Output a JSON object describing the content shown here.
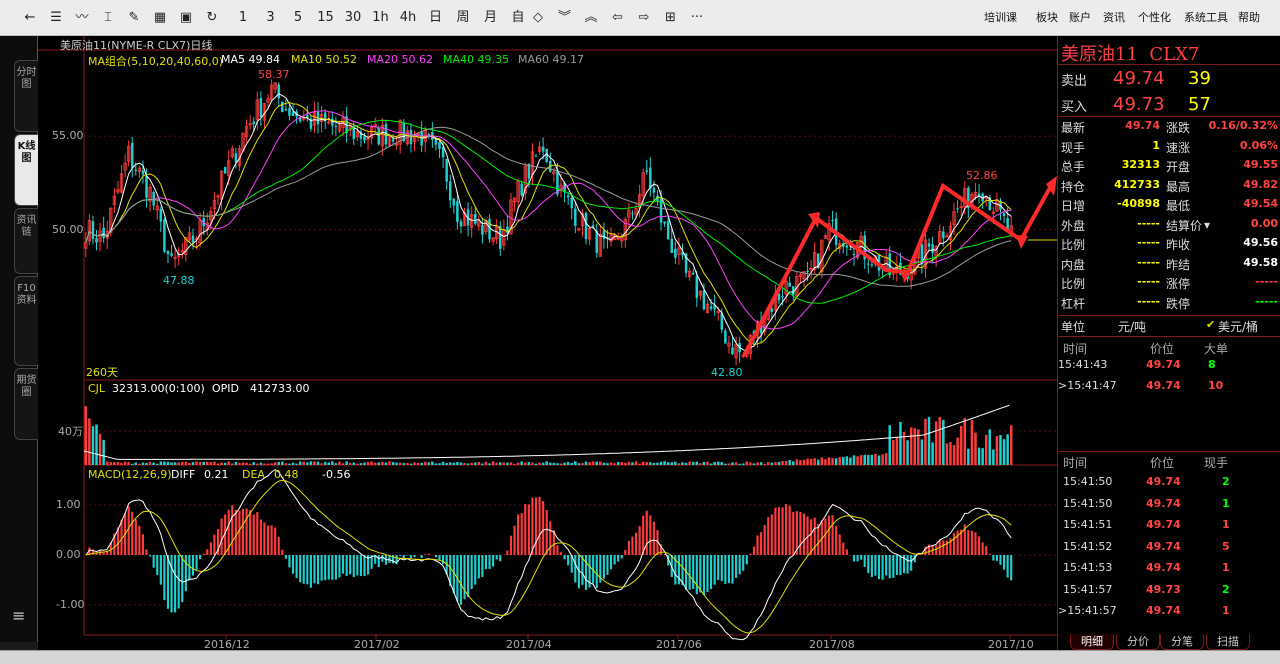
{
  "toolbar": {
    "buttons": [
      {
        "name": "back-arrow-icon",
        "glyph": "←"
      },
      {
        "name": "list-icon",
        "glyph": "☰"
      },
      {
        "name": "line-chart-icon",
        "glyph": "〰"
      },
      {
        "name": "candle-icon",
        "glyph": "⌶"
      },
      {
        "name": "tool-icon",
        "glyph": "✎"
      },
      {
        "name": "grid-icon",
        "glyph": "▦"
      },
      {
        "name": "save-icon",
        "glyph": "▣"
      },
      {
        "name": "refresh-icon",
        "glyph": "↻"
      }
    ],
    "periods": [
      "1",
      "3",
      "5",
      "15",
      "30",
      "1h",
      "4h",
      "日",
      "周",
      "月",
      "自"
    ],
    "nav_buttons": [
      {
        "name": "zoom-icon",
        "glyph": "◇"
      },
      {
        "name": "double-down-icon",
        "glyph": "︾"
      },
      {
        "name": "double-up-icon",
        "glyph": "︽"
      },
      {
        "name": "left-icon",
        "glyph": "⇦"
      },
      {
        "name": "right-icon",
        "glyph": "⇨"
      },
      {
        "name": "layout-icon",
        "glyph": "⊞"
      },
      {
        "name": "more-icon",
        "glyph": "···"
      }
    ],
    "menu": [
      "培训课",
      "板块",
      "账户",
      "资讯",
      "个性化",
      "系统工具",
      "帮助"
    ]
  },
  "sidebar": {
    "tabs": [
      {
        "label": "分时图",
        "active": false
      },
      {
        "label": "K线图",
        "active": true
      },
      {
        "label": "资讯链",
        "active": false
      },
      {
        "label": "F10资料",
        "active": false
      },
      {
        "label": "期货圈",
        "active": false
      }
    ],
    "menu_icon": "≡"
  },
  "chart": {
    "title": "美原油11(NYME-R CLX7)日线",
    "ma_legend": [
      {
        "text": "MA组合(5,10,20,40,60,0)",
        "color": "#e0e000"
      },
      {
        "text": "MA5 49.84",
        "color": "#ffffff"
      },
      {
        "text": "MA10 50.52",
        "color": "#e0e000"
      },
      {
        "text": "MA20 50.62",
        "color": "#ff40ff"
      },
      {
        "text": "MA40 49.35",
        "color": "#00ee00"
      },
      {
        "text": "MA60 49.17",
        "color": "#9a9a9a"
      }
    ],
    "period_days": "260天",
    "high_label": "58.37",
    "low_label": "42.80",
    "local_low_label": "47.88",
    "recent_high_label": "52.86",
    "volume_legend": [
      {
        "text": "CJL",
        "color": "#e0e000"
      },
      {
        "text": "32313.00(0:100)",
        "color": "#ffffff"
      },
      {
        "text": "OPID",
        "color": "#ffffff"
      },
      {
        "text": "412733.00",
        "color": "#ffffff"
      }
    ],
    "volume_tick": "40万",
    "macd_legend": [
      {
        "text": "MACD(12,26,9)",
        "color": "#e0e000"
      },
      {
        "text": "DIFF",
        "color": "#ffffff"
      },
      {
        "text": "0.21",
        "color": "#ffffff"
      },
      {
        "text": "DEA",
        "color": "#e0e000"
      },
      {
        "text": "0.48",
        "color": "#e0e000"
      },
      {
        "text": "-0.56",
        "color": "#ffffff"
      }
    ],
    "date_ticks": [
      "2016/12",
      "2017/02",
      "2017/04",
      "2017/06",
      "2017/08",
      "2017/10"
    ]
  },
  "chart_data": {
    "type": "candlestick",
    "price_axis_ticks": [
      "55.00",
      "50.00"
    ],
    "price_ylim": [
      42.0,
      59.5
    ],
    "macd_ticks": [
      "1.00",
      "0.00",
      "-1.00"
    ],
    "macd_ylim": [
      -1.6,
      1.8
    ],
    "key_prices": {
      "high": 58.37,
      "low": 42.8,
      "local_low": 47.88,
      "recent_high": 52.86
    },
    "price_path": [
      [
        0,
        50.0
      ],
      [
        5,
        49.5
      ],
      [
        12,
        54.0
      ],
      [
        18,
        52.0
      ],
      [
        24,
        48.0
      ],
      [
        32,
        50.0
      ],
      [
        38,
        52.5
      ],
      [
        45,
        55.5
      ],
      [
        52,
        57.5
      ],
      [
        56,
        56.5
      ],
      [
        62,
        55.8
      ],
      [
        70,
        55.5
      ],
      [
        78,
        55.0
      ],
      [
        86,
        55.2
      ],
      [
        94,
        55.0
      ],
      [
        100,
        53.5
      ],
      [
        104,
        51.0
      ],
      [
        110,
        50.2
      ],
      [
        116,
        49.5
      ],
      [
        122,
        52.5
      ],
      [
        128,
        54.5
      ],
      [
        133,
        52.0
      ],
      [
        140,
        50.0
      ],
      [
        146,
        48.8
      ],
      [
        152,
        50.5
      ],
      [
        157,
        53.0
      ],
      [
        162,
        50.0
      ],
      [
        168,
        47.5
      ],
      [
        174,
        46.0
      ],
      [
        180,
        44.0
      ],
      [
        184,
        43.2
      ],
      [
        190,
        45.5
      ],
      [
        196,
        47.0
      ],
      [
        202,
        47.2
      ],
      [
        208,
        50.0
      ],
      [
        214,
        49.5
      ],
      [
        220,
        48.5
      ],
      [
        226,
        47.5
      ],
      [
        232,
        48.2
      ],
      [
        238,
        49.5
      ],
      [
        244,
        51.0
      ],
      [
        250,
        52.5
      ],
      [
        255,
        51.0
      ],
      [
        259,
        49.7
      ]
    ]
  },
  "right_panel": {
    "contract": "美原油11  CLX7",
    "sell": {
      "label": "卖出",
      "price": "49.74",
      "qty": "39"
    },
    "buy": {
      "label": "买入",
      "price": "49.73",
      "qty": "57"
    },
    "stats_left": [
      {
        "label": "最新",
        "value": "49.74",
        "color": "#ff4444"
      },
      {
        "label": "现手",
        "value": "1",
        "color": "#ffff00"
      },
      {
        "label": "总手",
        "value": "32313",
        "color": "#ffff00"
      },
      {
        "label": "持仓",
        "value": "412733",
        "color": "#ffff00"
      },
      {
        "label": "日增",
        "value": "-40898",
        "color": "#ffff00"
      },
      {
        "label": "外盘",
        "value": "-----",
        "color": "#ffff00"
      },
      {
        "label": "比例",
        "value": "-----",
        "color": "#ffff00"
      },
      {
        "label": "内盘",
        "value": "-----",
        "color": "#ffff00"
      },
      {
        "label": "比例",
        "value": "-----",
        "color": "#ffff00"
      },
      {
        "label": "杠杆",
        "value": "-----",
        "color": "#ffff00"
      }
    ],
    "stats_right": [
      {
        "label": "涨跌",
        "value": "0.16/0.32%",
        "color": "#ff4444"
      },
      {
        "label": "速涨",
        "value": "0.06%",
        "color": "#ff4444"
      },
      {
        "label": "开盘",
        "value": "49.55",
        "color": "#ff4444"
      },
      {
        "label": "最高",
        "value": "49.82",
        "color": "#ff4444"
      },
      {
        "label": "最低",
        "value": "49.54",
        "color": "#ff4444"
      },
      {
        "label": "结算价",
        "value": "0.00",
        "color": "#ff4444"
      },
      {
        "label": "昨收",
        "value": "49.56",
        "color": "#ffffff"
      },
      {
        "label": "昨结",
        "value": "49.58",
        "color": "#ffffff"
      },
      {
        "label": "涨停",
        "value": "-----",
        "color": "#ff4444"
      },
      {
        "label": "跌停",
        "value": "-----",
        "color": "#00ff00"
      }
    ],
    "unit_label": "单位",
    "unit_value": "元/吨",
    "unit_alt": "美元/桶",
    "big_headers": [
      "时间",
      "价位",
      "大单"
    ],
    "big_orders": [
      {
        "time": "15:41:43",
        "price": "49.74",
        "qty": "8",
        "qty_color": "#00ff00"
      },
      {
        "time": ">15:41:47",
        "price": "49.74",
        "qty": "10",
        "qty_color": "#ff4444"
      }
    ],
    "tick_headers": [
      "时间",
      "价位",
      "现手"
    ],
    "ticks": [
      {
        "time": "15:41:50",
        "price": "49.74",
        "qty": "2",
        "qty_color": "#00ff00"
      },
      {
        "time": "15:41:50",
        "price": "49.74",
        "qty": "1",
        "qty_color": "#00ff00"
      },
      {
        "time": "15:41:51",
        "price": "49.74",
        "qty": "1",
        "qty_color": "#ff4444"
      },
      {
        "time": "15:41:52",
        "price": "49.74",
        "qty": "5",
        "qty_color": "#ff4444"
      },
      {
        "time": "15:41:53",
        "price": "49.74",
        "qty": "1",
        "qty_color": "#ff4444"
      },
      {
        "time": "15:41:57",
        "price": "49.73",
        "qty": "2",
        "qty_color": "#00ff00"
      },
      {
        "time": ">15:41:57",
        "price": "49.74",
        "qty": "1",
        "qty_color": "#ff4444"
      }
    ],
    "bottom_tabs": [
      "明细",
      "分价",
      "分笔",
      "扫描"
    ]
  }
}
